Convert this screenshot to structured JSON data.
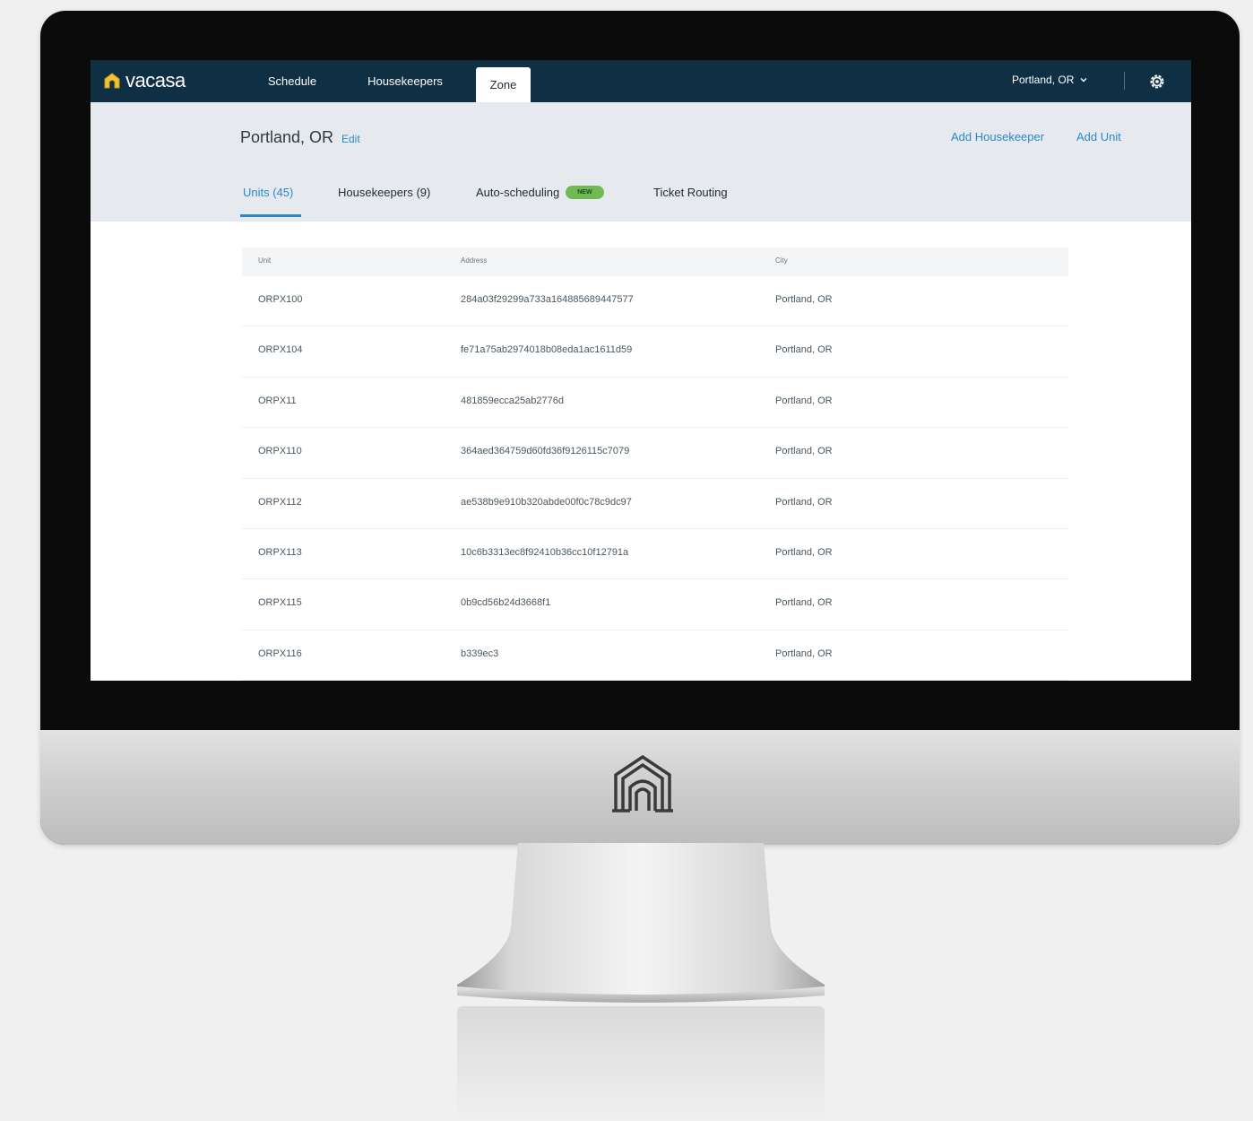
{
  "app": {
    "brand": "vacasa",
    "nav_tabs": [
      {
        "label": "Schedule"
      },
      {
        "label": "Housekeepers"
      },
      {
        "label": "Zone",
        "active": true
      }
    ],
    "location_selector": "Portland, OR"
  },
  "header": {
    "title": "Portland, OR",
    "edit_label": "Edit",
    "add_housekeeper_label": "Add Housekeeper",
    "add_unit_label": "Add Unit"
  },
  "subtabs": [
    {
      "label": "Units (45)",
      "active": true
    },
    {
      "label": "Housekeepers (9)"
    },
    {
      "label": "Auto-scheduling",
      "badge": "NEW"
    },
    {
      "label": "Ticket Routing"
    }
  ],
  "table": {
    "columns": [
      "Unit",
      "Address",
      "City"
    ],
    "rows": [
      [
        "ORPX100",
        "284a03f29299a733a164885689447577",
        "Portland, OR"
      ],
      [
        "ORPX104",
        "fe71a75ab2974018b08eda1ac1611d59",
        "Portland, OR"
      ],
      [
        "ORPX11",
        "481859ecca25ab2776d",
        "Portland, OR"
      ],
      [
        "ORPX110",
        "364aed364759d60fd36f9126115c7079",
        "Portland, OR"
      ],
      [
        "ORPX112",
        "ae538b9e910b320abde00f0c78c9dc97",
        "Portland, OR"
      ],
      [
        "ORPX113",
        "10c6b3313ec8f92410b36cc10f12791a",
        "Portland, OR"
      ],
      [
        "ORPX115",
        "0b9cd56b24d3668f1",
        "Portland, OR"
      ],
      [
        "ORPX116",
        "b339ec3",
        "Portland, OR"
      ]
    ]
  },
  "colors": {
    "nav_bg": "#0f3044",
    "header_bg": "#e6eaee",
    "link": "#2b87c9",
    "badge": "#6fba55"
  },
  "icons": [
    "vacasa-logo-icon",
    "chevron-down-icon",
    "gear-icon",
    "vacasa-house-emblem-icon"
  ]
}
